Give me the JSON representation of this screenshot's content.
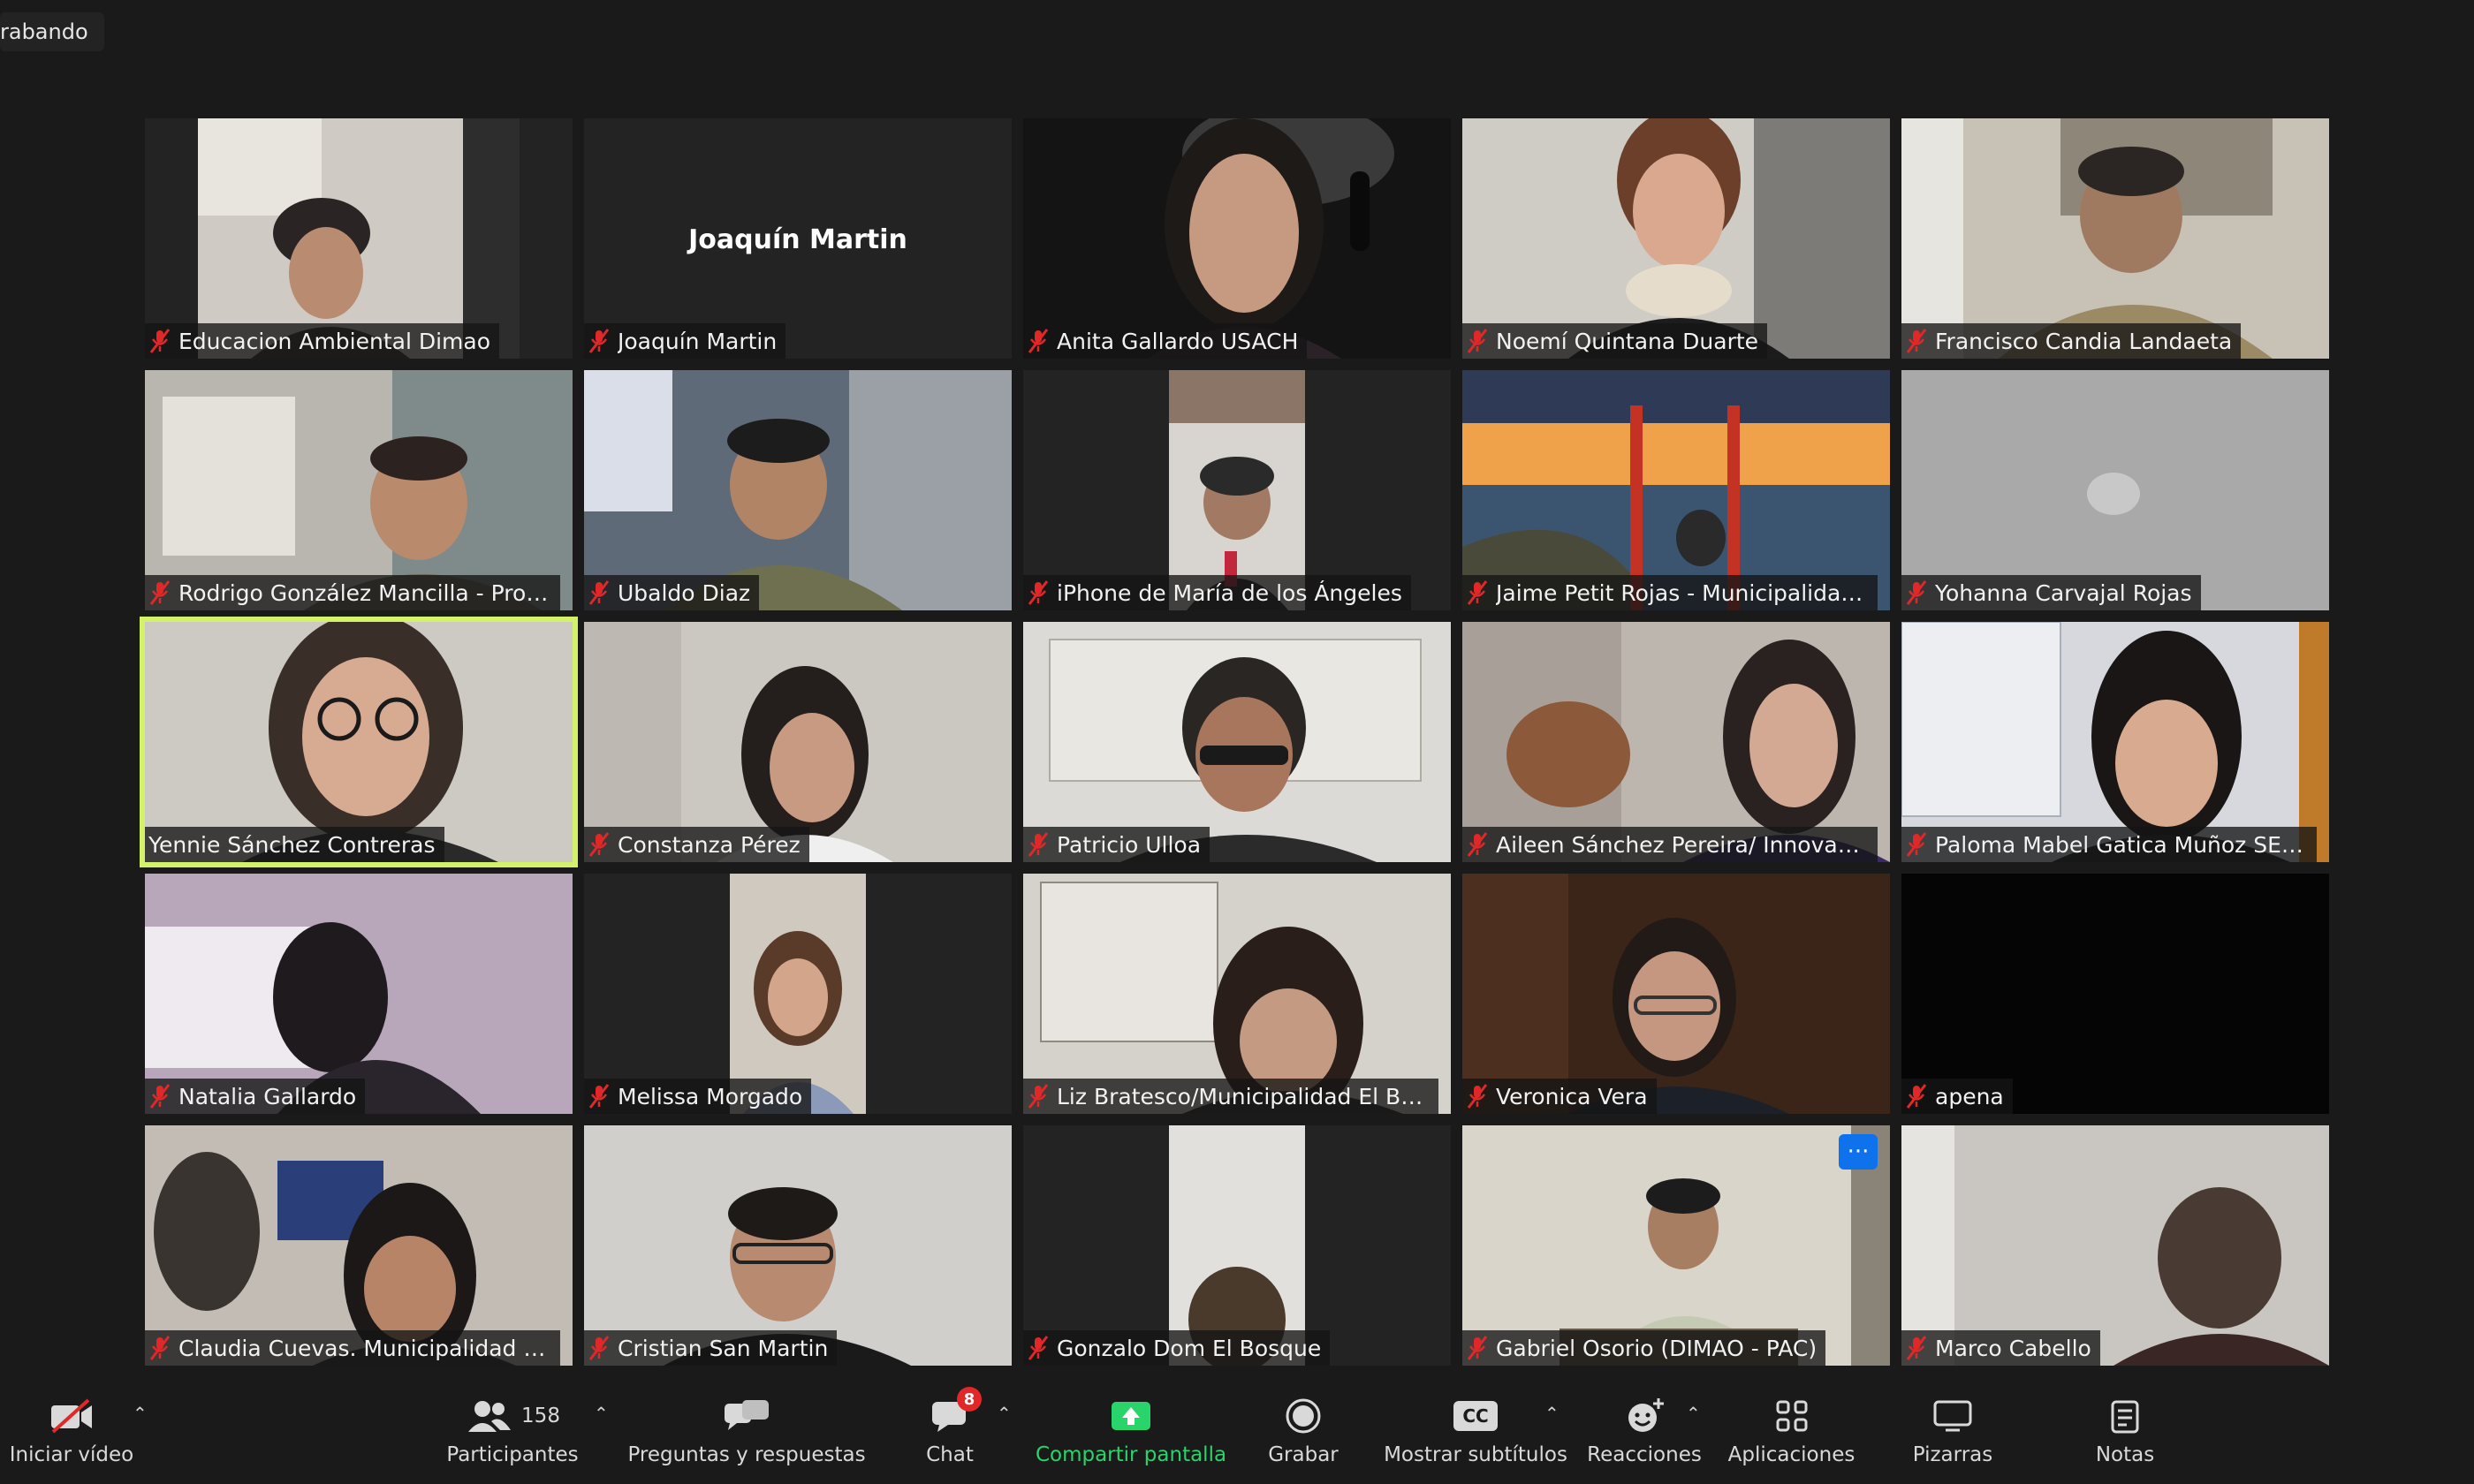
{
  "recording": {
    "label": "rabando"
  },
  "participants": [
    {
      "name": "Educacion Ambiental Dimao",
      "muted": true
    },
    {
      "name": "Joaquín Martin",
      "muted": true,
      "display_name": "Joaquín Martin"
    },
    {
      "name": "Anita Gallardo USACH",
      "muted": true
    },
    {
      "name": "Noemí Quintana Duarte",
      "muted": true
    },
    {
      "name": "Francisco Candia Landaeta",
      "muted": true
    },
    {
      "name": "Rodrigo González Mancilla - Progr...",
      "muted": true
    },
    {
      "name": "Ubaldo Diaz",
      "muted": true
    },
    {
      "name": "iPhone de María de los Ángeles",
      "muted": true
    },
    {
      "name": "Jaime Petit Rojas - Municipalidad L...",
      "muted": true
    },
    {
      "name": "Yohanna Carvajal Rojas",
      "muted": true
    },
    {
      "name": "Yennie Sánchez Contreras",
      "muted": false,
      "speaking": true
    },
    {
      "name": "Constanza Pérez",
      "muted": true
    },
    {
      "name": "Patricio Ulloa",
      "muted": true
    },
    {
      "name": "Aileen Sánchez Pereira/ Innovación ...",
      "muted": true
    },
    {
      "name": "Paloma Mabel Gatica Muñoz SECP...",
      "muted": true
    },
    {
      "name": "Natalia Gallardo",
      "muted": true
    },
    {
      "name": "Melissa Morgado",
      "muted": true
    },
    {
      "name": "Liz Bratesco/Municipalidad El Bosq...",
      "muted": true
    },
    {
      "name": "Veronica Vera",
      "muted": true
    },
    {
      "name": "apena",
      "muted": true
    },
    {
      "name": "Claudia Cuevas. Municipalidad de L...",
      "muted": true
    },
    {
      "name": "Cristian San Martin",
      "muted": true
    },
    {
      "name": "Gonzalo Dom El Bosque",
      "muted": true
    },
    {
      "name": "Gabriel Osorio (DIMAO - PAC)",
      "muted": true
    },
    {
      "name": "Marco Cabello",
      "muted": true
    }
  ],
  "toolbar": {
    "start_video": "Iniciar vídeo",
    "participants": "Participantes",
    "participants_count": "158",
    "qa": "Preguntas y respuestas",
    "chat": "Chat",
    "chat_badge": "8",
    "share": "Compartir pantalla",
    "record": "Grabar",
    "captions": "Mostrar subtítulos",
    "captions_icon_text": "CC",
    "reactions": "Reacciones",
    "apps": "Aplicaciones",
    "whiteboards": "Pizarras",
    "notes": "Notas"
  },
  "colors": {
    "background": "#1a1a1a",
    "active_speaker_border": "#d4f16a",
    "muted_mic": "#e02828",
    "share_green": "#29d46a",
    "more_button": "#0e72ed"
  },
  "icons": {
    "start_video": "video-off-icon",
    "participants": "people-icon",
    "qa": "chat-bubbles-icon",
    "chat": "chat-icon",
    "share": "share-screen-icon",
    "record": "record-icon",
    "captions": "cc-icon",
    "reactions": "emoji-plus-icon",
    "apps": "apps-icon",
    "whiteboards": "whiteboard-icon",
    "notes": "notes-icon",
    "muted": "mic-muted-icon",
    "more": "more-options-icon"
  }
}
